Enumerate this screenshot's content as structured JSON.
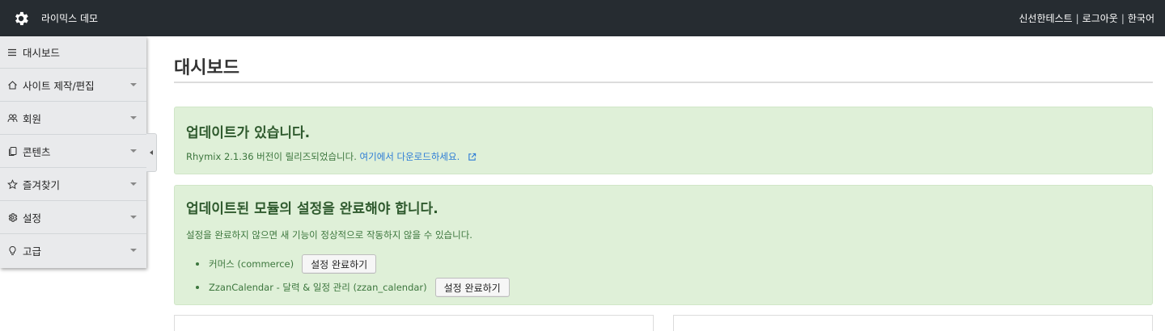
{
  "header": {
    "site_name": "라이믹스 데모",
    "user_name": "신선한테스트",
    "logout": "로그아웃",
    "language": "한국어",
    "separator": "|",
    "logo_icon": "gear-icon"
  },
  "sidebar": {
    "items": [
      {
        "label": "대시보드",
        "icon": "menu-icon"
      },
      {
        "label": "사이트 제작/편집",
        "icon": "home-icon"
      },
      {
        "label": "회원",
        "icon": "users-icon"
      },
      {
        "label": "콘텐츠",
        "icon": "documents-icon"
      },
      {
        "label": "즐겨찾기",
        "icon": "star-icon"
      },
      {
        "label": "설정",
        "icon": "gear-icon"
      },
      {
        "label": "고급",
        "icon": "lightbulb-icon"
      }
    ]
  },
  "main": {
    "title": "대시보드",
    "update_alert": {
      "heading": "업데이트가 있습니다.",
      "message": "Rhymix 2.1.36 버전이 릴리즈되었습니다.",
      "link": "여기에서 다운로드하세요."
    },
    "module_alert": {
      "heading": "업데이트된 모듈의 설정을 완료해야 합니다.",
      "message": "설정을 완료하지 않으면 새 기능이 정상적으로 작동하지 않을 수 있습니다.",
      "modules": [
        {
          "label": "커머스 (commerce)",
          "button": "설정 완료하기"
        },
        {
          "label": "ZzanCalendar - 달력 & 일정 관리 (zzan_calendar)",
          "button": "설정 완료하기"
        }
      ]
    }
  },
  "colors": {
    "topbar": "#262c31",
    "sidebar": "#e9eaec",
    "alert_bg": "#dff0d8",
    "alert_text": "#3c763d",
    "link": "#2b7bd6"
  }
}
